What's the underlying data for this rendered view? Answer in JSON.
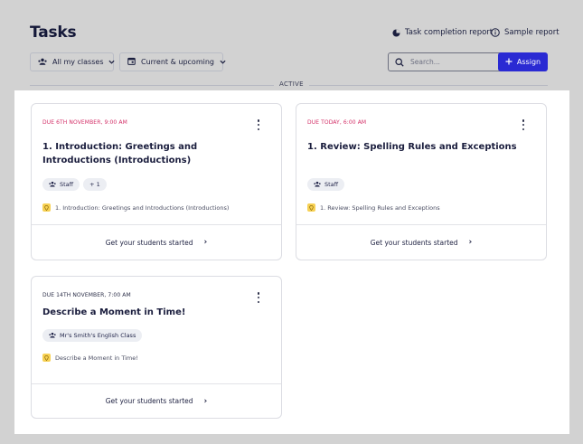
{
  "header": {
    "title": "Tasks",
    "task_report_label": "Task completion report",
    "sample_report_label": "Sample report",
    "classes_filter_label": "All my classes",
    "timeframe_filter_label": "Current & upcoming",
    "search_placeholder": "Search...",
    "assign_label": "Assign",
    "section_label": "ACTIVE"
  },
  "colors": {
    "accent": "#2a2ad3",
    "due_today": "#d32f67",
    "resource_pin": "#f7d154"
  },
  "cards": [
    {
      "due": "DUE 6TH NOVEMBER, 9:00 AM",
      "title": "1. Introduction: Greetings and Introductions (Introductions)",
      "chips": [
        "Staff",
        "+ 1"
      ],
      "resource": "1. Introduction: Greetings and Introductions (Introductions)",
      "footer": "Get your students started"
    },
    {
      "due": "DUE TODAY, 6:00 AM",
      "title": "1. Review: Spelling Rules and Exceptions",
      "chips": [
        "Staff"
      ],
      "resource": "1. Review: Spelling Rules and Exceptions",
      "footer": "Get your students started"
    },
    {
      "due": "DUE 14TH NOVEMBER, 7:00 AM",
      "title": "Describe a Moment in Time!",
      "chips": [
        "Mr's Smith's English Class"
      ],
      "resource": "Describe a Moment in Time!",
      "footer": "Get your students started"
    }
  ]
}
